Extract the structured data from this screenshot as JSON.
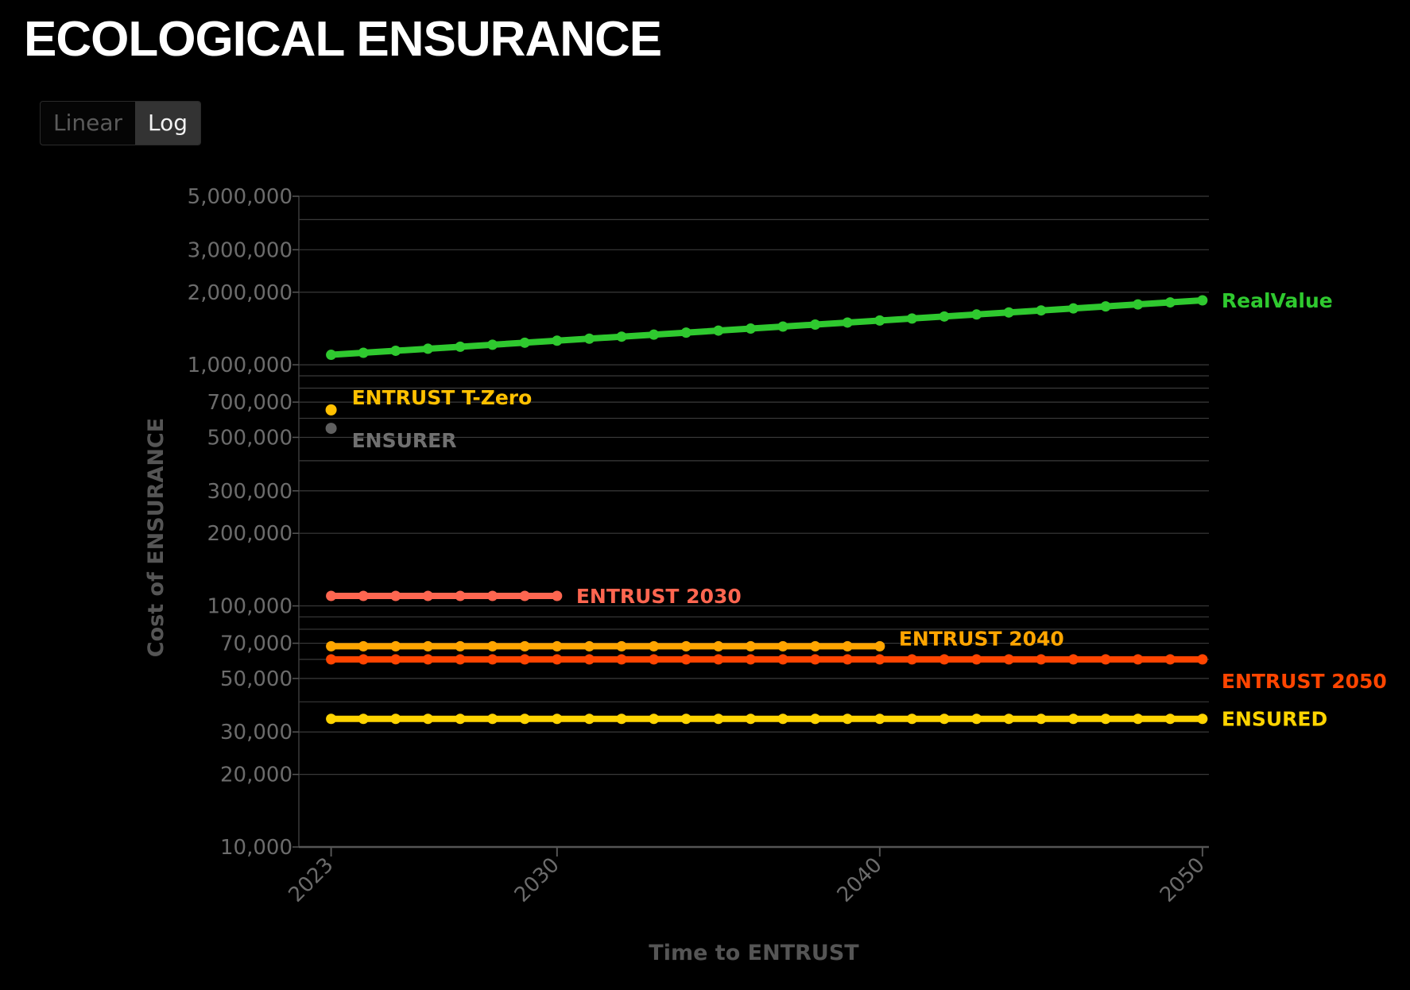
{
  "page": {
    "title": "ECOLOGICAL ENSURANCE"
  },
  "scale_toggle": {
    "options": [
      "Linear",
      "Log"
    ],
    "selected": "Log"
  },
  "chart_data": {
    "type": "line",
    "yscale": "log",
    "xlabel": "Time to ENTRUST",
    "ylabel": "Cost of ENSURANCE",
    "xlim": [
      2022,
      2050.2
    ],
    "ylim": [
      10000,
      5000000
    ],
    "x_ticks": [
      2023,
      2030,
      2040,
      2050
    ],
    "y_ticks": [
      10000,
      20000,
      30000,
      50000,
      70000,
      100000,
      200000,
      300000,
      500000,
      700000,
      1000000,
      2000000,
      3000000,
      5000000
    ],
    "y_tick_labels": [
      "10,000",
      "20,000",
      "30,000",
      "50,000",
      "70,000",
      "100,000",
      "200,000",
      "300,000",
      "500,000",
      "700,000",
      "1,000,000",
      "2,000,000",
      "3,000,000",
      "5,000,000"
    ],
    "minor_gridlines": [
      40000,
      60000,
      80000,
      90000,
      400000,
      600000,
      800000,
      900000,
      4000000
    ],
    "grid": true,
    "series": [
      {
        "name": "RealValue",
        "color": "#2fc92f",
        "start": 2023,
        "end": 2050,
        "start_value": 1100000,
        "end_value": 1850000,
        "markers": true
      },
      {
        "name": "ENTRUST 2030",
        "color": "#ff6650",
        "start": 2023,
        "end": 2030,
        "start_value": 110000,
        "end_value": 110000,
        "markers": true
      },
      {
        "name": "ENTRUST 2040",
        "color": "#ffa500",
        "start": 2023,
        "end": 2040,
        "start_value": 68000,
        "end_value": 68000,
        "markers": true
      },
      {
        "name": "ENTRUST 2050",
        "color": "#ff4500",
        "start": 2023,
        "end": 2050,
        "start_value": 60000,
        "end_value": 60000,
        "markers": true
      },
      {
        "name": "ENSURED",
        "color": "#ffd400",
        "start": 2023,
        "end": 2050,
        "start_value": 34000,
        "end_value": 34000,
        "markers": true
      }
    ],
    "points": [
      {
        "name": "ENTRUST T-Zero",
        "color": "#ffc000",
        "x": 2023,
        "y": 650000
      },
      {
        "name": "ENSURER",
        "color": "#606060",
        "label_color": "#707070",
        "x": 2023,
        "y": 545000
      }
    ]
  }
}
